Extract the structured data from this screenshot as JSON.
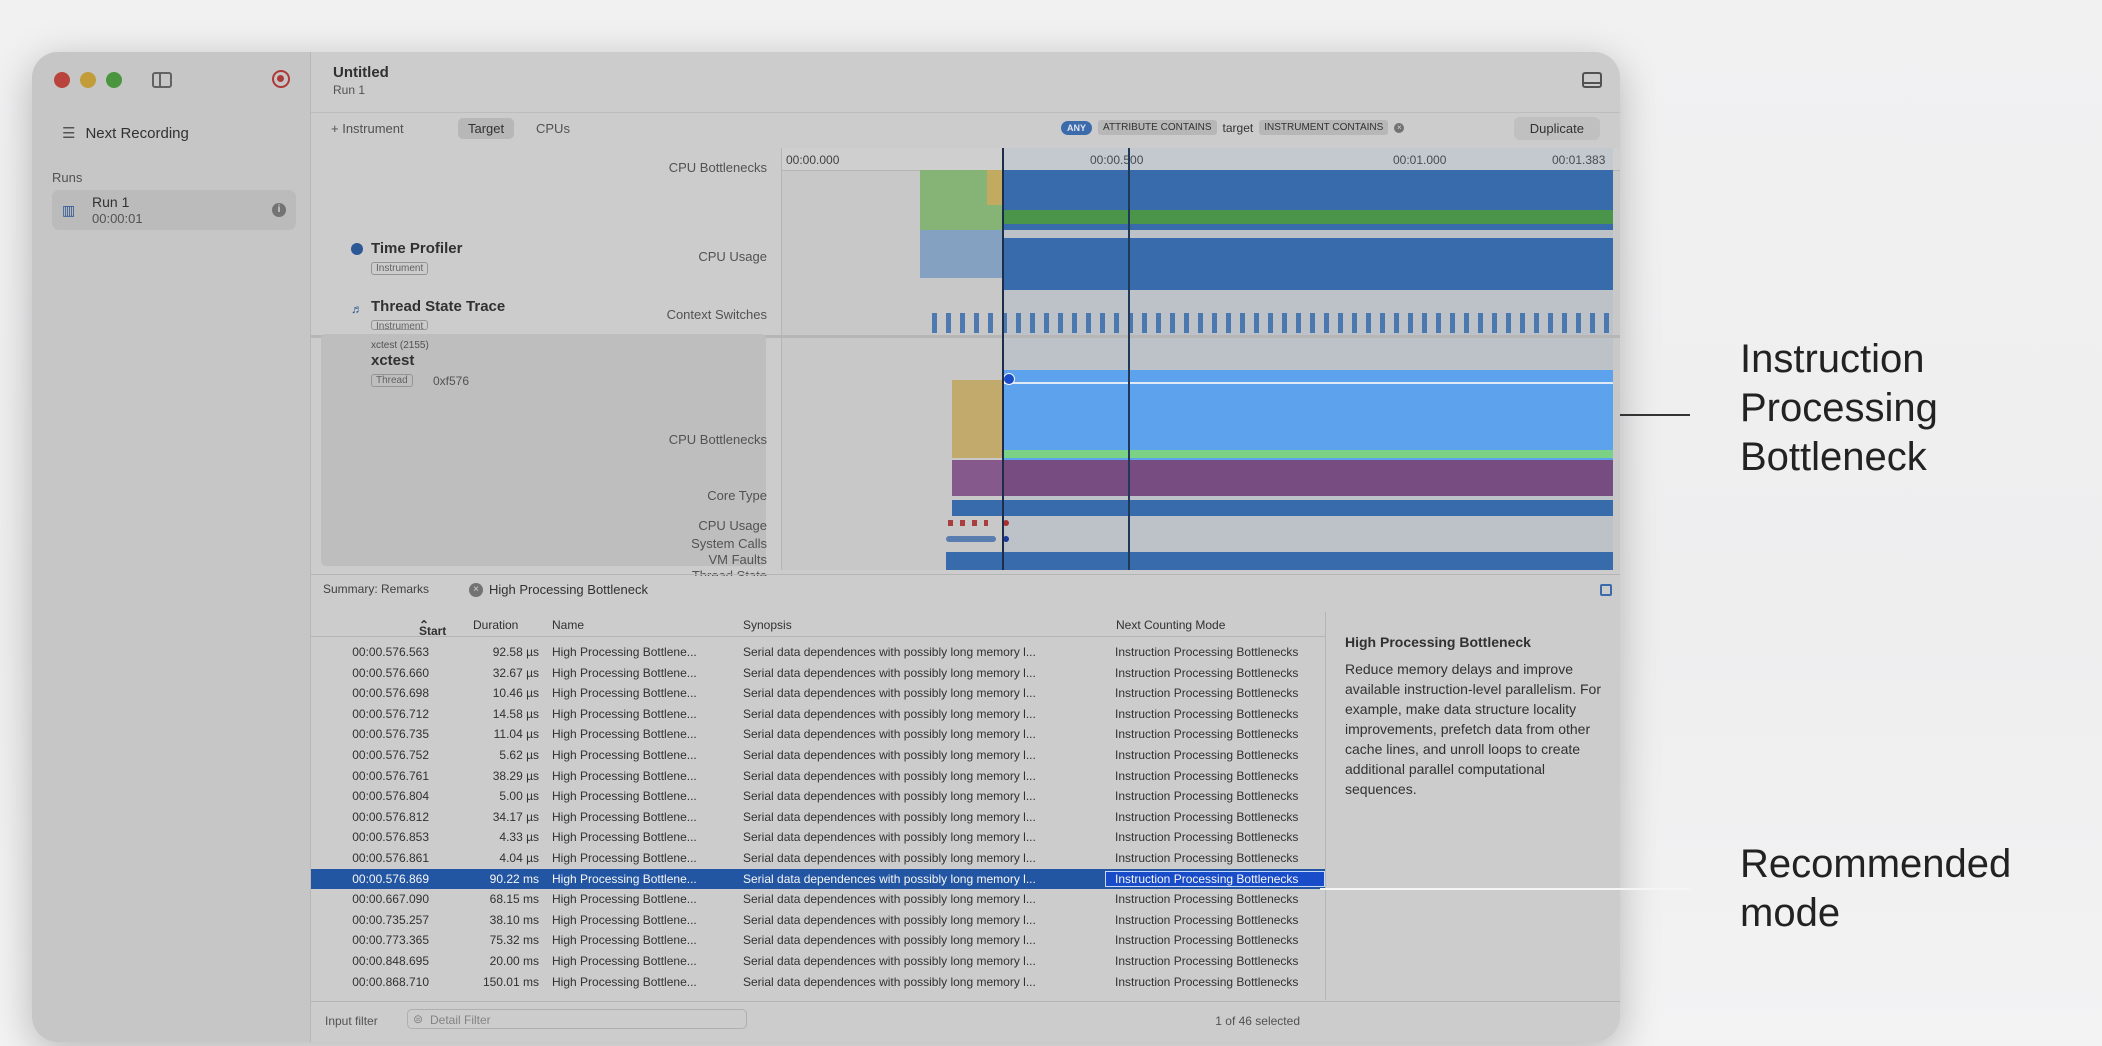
{
  "window": {
    "title": "Untitled",
    "subtitle": "Run 1"
  },
  "sidebar": {
    "next_recording": "Next Recording",
    "runs_label": "Runs",
    "run": {
      "name": "Run 1",
      "time": "00:00:01"
    }
  },
  "toolbar": {
    "add_instrument": "+ Instrument",
    "tab_target": "Target",
    "tab_cpus": "CPUs",
    "filter": {
      "any": "ANY",
      "attribute": "ATTRIBUTE CONTAINS",
      "term": "target",
      "instrument": "INSTRUMENT CONTAINS"
    },
    "duplicate": "Duplicate"
  },
  "ruler": {
    "t0": "00:00.000",
    "t1": "00:00.500",
    "t2": "00:01.000",
    "t3": "00:01.383"
  },
  "tracks": {
    "cpu_bottlenecks_top": "CPU Bottlenecks",
    "time_profiler": "Time Profiler",
    "time_profiler_tag": "Instrument",
    "cpu_usage_top": "CPU Usage",
    "thread_state_trace": "Thread State Trace",
    "thread_state_tag": "Instrument",
    "context_switches": "Context Switches",
    "process": "xctest (2155)",
    "process_name": "xctest",
    "thread_tag": "Thread",
    "thread_id": "0xf576",
    "cpu_bottlenecks": "CPU Bottlenecks",
    "core_type": "Core Type",
    "cpu_usage": "CPU Usage",
    "system_calls": "System Calls",
    "vm_faults": "VM Faults",
    "thread_state": "Thread State"
  },
  "summary": {
    "selector": "Summary: Remarks",
    "filter_token": "High Processing Bottleneck"
  },
  "table": {
    "headers": {
      "start": "Start",
      "duration": "Duration",
      "name": "Name",
      "synopsis": "Synopsis",
      "mode": "Next Counting Mode"
    },
    "rows": [
      {
        "start": "00:00.576.563",
        "duration": "92.58 µs",
        "name": "High Processing Bottlene...",
        "synopsis": "Serial data dependences with possibly long memory l...",
        "mode": "Instruction Processing Bottlenecks"
      },
      {
        "start": "00:00.576.660",
        "duration": "32.67 µs",
        "name": "High Processing Bottlene...",
        "synopsis": "Serial data dependences with possibly long memory l...",
        "mode": "Instruction Processing Bottlenecks"
      },
      {
        "start": "00:00.576.698",
        "duration": "10.46 µs",
        "name": "High Processing Bottlene...",
        "synopsis": "Serial data dependences with possibly long memory l...",
        "mode": "Instruction Processing Bottlenecks"
      },
      {
        "start": "00:00.576.712",
        "duration": "14.58 µs",
        "name": "High Processing Bottlene...",
        "synopsis": "Serial data dependences with possibly long memory l...",
        "mode": "Instruction Processing Bottlenecks"
      },
      {
        "start": "00:00.576.735",
        "duration": "11.04 µs",
        "name": "High Processing Bottlene...",
        "synopsis": "Serial data dependences with possibly long memory l...",
        "mode": "Instruction Processing Bottlenecks"
      },
      {
        "start": "00:00.576.752",
        "duration": "5.62 µs",
        "name": "High Processing Bottlene...",
        "synopsis": "Serial data dependences with possibly long memory l...",
        "mode": "Instruction Processing Bottlenecks"
      },
      {
        "start": "00:00.576.761",
        "duration": "38.29 µs",
        "name": "High Processing Bottlene...",
        "synopsis": "Serial data dependences with possibly long memory l...",
        "mode": "Instruction Processing Bottlenecks"
      },
      {
        "start": "00:00.576.804",
        "duration": "5.00 µs",
        "name": "High Processing Bottlene...",
        "synopsis": "Serial data dependences with possibly long memory l...",
        "mode": "Instruction Processing Bottlenecks"
      },
      {
        "start": "00:00.576.812",
        "duration": "34.17 µs",
        "name": "High Processing Bottlene...",
        "synopsis": "Serial data dependences with possibly long memory l...",
        "mode": "Instruction Processing Bottlenecks"
      },
      {
        "start": "00:00.576.853",
        "duration": "4.33 µs",
        "name": "High Processing Bottlene...",
        "synopsis": "Serial data dependences with possibly long memory l...",
        "mode": "Instruction Processing Bottlenecks"
      },
      {
        "start": "00:00.576.861",
        "duration": "4.04 µs",
        "name": "High Processing Bottlene...",
        "synopsis": "Serial data dependences with possibly long memory l...",
        "mode": "Instruction Processing Bottlenecks"
      },
      {
        "start": "00:00.576.869",
        "duration": "90.22 ms",
        "name": "High Processing Bottlene...",
        "synopsis": "Serial data dependences with possibly long memory l...",
        "mode": "Instruction Processing Bottlenecks",
        "selected": true
      },
      {
        "start": "00:00.667.090",
        "duration": "68.15 ms",
        "name": "High Processing Bottlene...",
        "synopsis": "Serial data dependences with possibly long memory l...",
        "mode": "Instruction Processing Bottlenecks"
      },
      {
        "start": "00:00.735.257",
        "duration": "38.10 ms",
        "name": "High Processing Bottlene...",
        "synopsis": "Serial data dependences with possibly long memory l...",
        "mode": "Instruction Processing Bottlenecks"
      },
      {
        "start": "00:00.773.365",
        "duration": "75.32 ms",
        "name": "High Processing Bottlene...",
        "synopsis": "Serial data dependences with possibly long memory l...",
        "mode": "Instruction Processing Bottlenecks"
      },
      {
        "start": "00:00.848.695",
        "duration": "20.00 ms",
        "name": "High Processing Bottlene...",
        "synopsis": "Serial data dependences with possibly long memory l...",
        "mode": "Instruction Processing Bottlenecks"
      },
      {
        "start": "00:00.868.710",
        "duration": "150.01 ms",
        "name": "High Processing Bottlene...",
        "synopsis": "Serial data dependences with possibly long memory l...",
        "mode": "Instruction Processing Bottlenecks"
      }
    ]
  },
  "detail": {
    "title": "High Processing Bottleneck",
    "text": "Reduce memory delays and improve available instruction-level parallelism. For example, make data structure locality improvements, prefetch data from other cache lines, and unroll loops to create additional parallel computational sequences."
  },
  "footer": {
    "input_filter": "Input filter",
    "detail_filter_placeholder": "Detail Filter",
    "count": "1 of 46 selected"
  },
  "callouts": {
    "top": "Instruction Processing Bottleneck",
    "bottom": "Recommended mode"
  },
  "colors": {
    "selection_blue": "#2458a8",
    "bottleneck_blue": "#5fa8f5",
    "green": "#7fd88a",
    "purple": "#7b4f86"
  }
}
